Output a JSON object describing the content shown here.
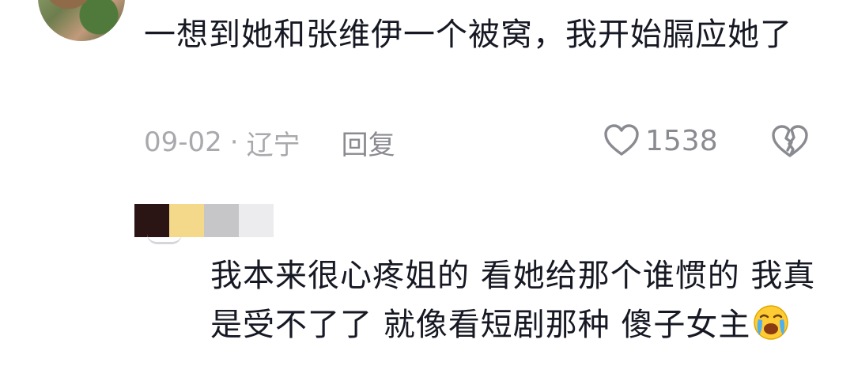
{
  "comment_top": {
    "text": "一想到她和张维伊一个被窝，我开始膈应她了",
    "date": "09-02",
    "separator": "·",
    "location": "辽宁",
    "reply_label": "回复",
    "like_count": "1538"
  },
  "comment_second": {
    "text": "我本来很心疼姐的 看她给那个谁惯的 我真是受不了了 就像看短剧那种 傻子女主",
    "emoji": "loudly-crying-face-emoji",
    "censor_colors": [
      "#2a1414",
      "#f4d98a",
      "#c6c6c8",
      "#ececef"
    ]
  },
  "colors": {
    "text_primary": "#161823",
    "text_secondary": "#a8a9ad",
    "icon_gray": "#8a8b91"
  }
}
